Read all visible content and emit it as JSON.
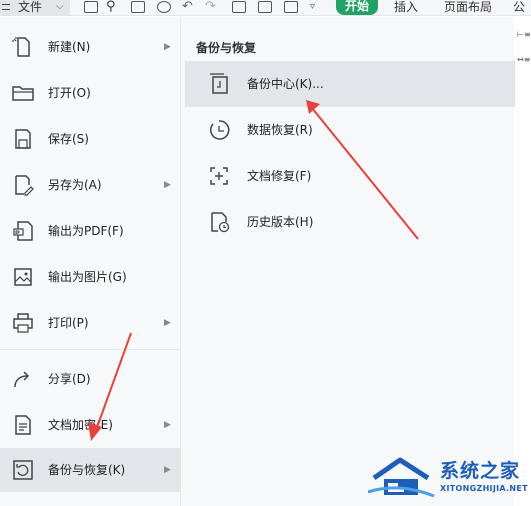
{
  "toolbar": {
    "file_label": "文件",
    "start_label": "开始",
    "insert_label": "插入",
    "layout_label": "页面布局",
    "more_label": "公",
    "start_color": "#21a366"
  },
  "menu": {
    "items": [
      {
        "label": "新建(N)",
        "icon": "new-file-icon",
        "arrow": true
      },
      {
        "label": "打开(O)",
        "icon": "folder-icon",
        "arrow": false
      },
      {
        "label": "保存(S)",
        "icon": "save-icon",
        "arrow": false
      },
      {
        "label": "另存为(A)",
        "icon": "save-as-icon",
        "arrow": true
      },
      {
        "label": "输出为PDF(F)",
        "icon": "pdf-icon",
        "arrow": false
      },
      {
        "label": "输出为图片(G)",
        "icon": "image-icon",
        "arrow": false
      },
      {
        "label": "打印(P)",
        "icon": "printer-icon",
        "arrow": true
      },
      {
        "label": "分享(D)",
        "icon": "share-icon",
        "arrow": false
      },
      {
        "label": "文档加密(E)",
        "icon": "encrypt-doc-icon",
        "arrow": true
      },
      {
        "label": "备份与恢复(K)",
        "icon": "backup-restore-icon",
        "arrow": true,
        "active": true
      }
    ]
  },
  "submenu": {
    "title": "备份与恢复",
    "items": [
      {
        "label": "备份中心(K)...",
        "icon": "backup-center-icon",
        "active": true
      },
      {
        "label": "数据恢复(R)",
        "icon": "data-recovery-icon"
      },
      {
        "label": "文档修复(F)",
        "icon": "doc-repair-icon"
      },
      {
        "label": "历史版本(H)",
        "icon": "history-version-icon"
      }
    ]
  },
  "annotation": {
    "arrow_color": "#e8413b"
  },
  "watermark": {
    "text": "系统之家",
    "sub": "XITONGZHIJIA.NET",
    "color": "#1d5fb8"
  }
}
